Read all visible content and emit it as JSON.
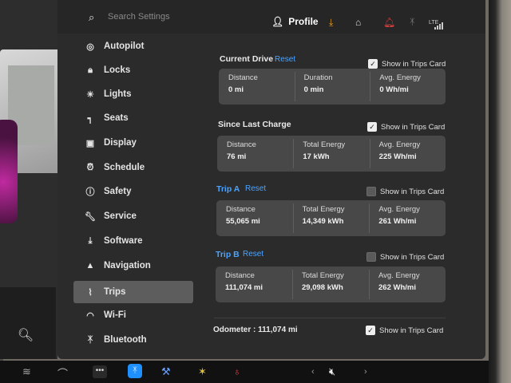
{
  "search": {
    "placeholder": "Search Settings"
  },
  "header": {
    "profile_label": "Profile",
    "lte_label": "LTE"
  },
  "sidebar": {
    "items": [
      {
        "label": "Autopilot"
      },
      {
        "label": "Locks"
      },
      {
        "label": "Lights"
      },
      {
        "label": "Seats"
      },
      {
        "label": "Display"
      },
      {
        "label": "Schedule"
      },
      {
        "label": "Safety"
      },
      {
        "label": "Service"
      },
      {
        "label": "Software"
      },
      {
        "label": "Navigation"
      },
      {
        "label": "Trips",
        "active": true
      },
      {
        "label": "Wi-Fi"
      },
      {
        "label": "Bluetooth"
      }
    ]
  },
  "trips": {
    "current_drive": {
      "title": "Current Drive",
      "reset_label": "Reset",
      "show_in_trips_card": {
        "label": "Show in Trips Card",
        "checked": true
      },
      "stats": [
        {
          "label": "Distance",
          "value": "0 mi"
        },
        {
          "label": "Duration",
          "value": "0 min"
        },
        {
          "label": "Avg. Energy",
          "value": "0 Wh/mi"
        }
      ]
    },
    "since_last_charge": {
      "title": "Since Last Charge",
      "show_in_trips_card": {
        "label": "Show in Trips Card",
        "checked": true
      },
      "stats": [
        {
          "label": "Distance",
          "value": "76 mi"
        },
        {
          "label": "Total Energy",
          "value": "17 kWh"
        },
        {
          "label": "Avg. Energy",
          "value": "225 Wh/mi"
        }
      ]
    },
    "trip_a": {
      "title": "Trip A",
      "reset_label": "Reset",
      "show_in_trips_card": {
        "label": "Show in Trips Card",
        "checked": false
      },
      "stats": [
        {
          "label": "Distance",
          "value": "55,065 mi"
        },
        {
          "label": "Total Energy",
          "value": "14,349 kWh"
        },
        {
          "label": "Avg. Energy",
          "value": "261 Wh/mi"
        }
      ]
    },
    "trip_b": {
      "title": "Trip B",
      "reset_label": "Reset",
      "show_in_trips_card": {
        "label": "Show in Trips Card",
        "checked": false
      },
      "stats": [
        {
          "label": "Distance",
          "value": "111,074 mi"
        },
        {
          "label": "Total Energy",
          "value": "29,098 kWh"
        },
        {
          "label": "Avg. Energy",
          "value": "262 Wh/mi"
        }
      ]
    },
    "odometer": {
      "label": "Odometer : 111,074 mi",
      "show_in_trips_card": {
        "label": "Show in Trips Card",
        "checked": true
      }
    }
  },
  "colors": {
    "accent": "#4aa3ff",
    "panel": "#2b2b2b",
    "card": "#484848",
    "active_item": "#5d5d5d"
  }
}
